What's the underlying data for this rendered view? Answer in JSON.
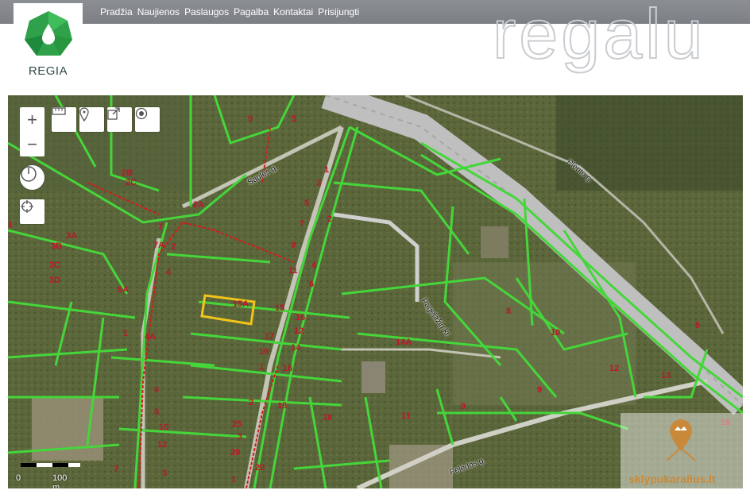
{
  "nav": {
    "items": [
      "Pradžia",
      "Naujienos",
      "Paslaugos",
      "Pagalba",
      "Kontaktai",
      "Prisijungti"
    ]
  },
  "logo": {
    "text": "REGIA"
  },
  "watermark": {
    "text": "regalu"
  },
  "map": {
    "street_labels": {
      "plento": "Plento g.",
      "peledos": "Pelėdos g.",
      "saules": "Saulės g.",
      "pagelia": "Pagelažių kr."
    },
    "parcels": [
      "9",
      "5",
      "1",
      "3",
      "2B",
      "2C",
      "2A",
      "5",
      "2",
      "7",
      "7",
      "3A",
      "3B",
      "3C",
      "3D",
      "7A",
      "2",
      "9",
      "4",
      "11",
      "6",
      "4",
      "9A",
      "15A",
      "15",
      "16",
      "1",
      "4A",
      "17",
      "12",
      "14",
      "19",
      "14A",
      "16",
      "1",
      "6",
      "2",
      "8",
      "18",
      "18",
      "25",
      "11",
      "9",
      "10",
      "3",
      "29",
      "12",
      "20",
      "7",
      "1",
      "3",
      "1",
      "8",
      "10",
      "12",
      "13",
      "9",
      "5",
      "16",
      "10"
    ],
    "scale": {
      "zero": "0",
      "distance": "100 m"
    },
    "controls": {
      "zoom_in": "+",
      "zoom_out": "−"
    }
  },
  "corner_watermark": {
    "text": "sklypukaralius.lt"
  },
  "colors": {
    "parcel_line": "#45d63a",
    "label": "#c0142a",
    "highlight": "#f0c419",
    "road": "#c9c9c9"
  }
}
